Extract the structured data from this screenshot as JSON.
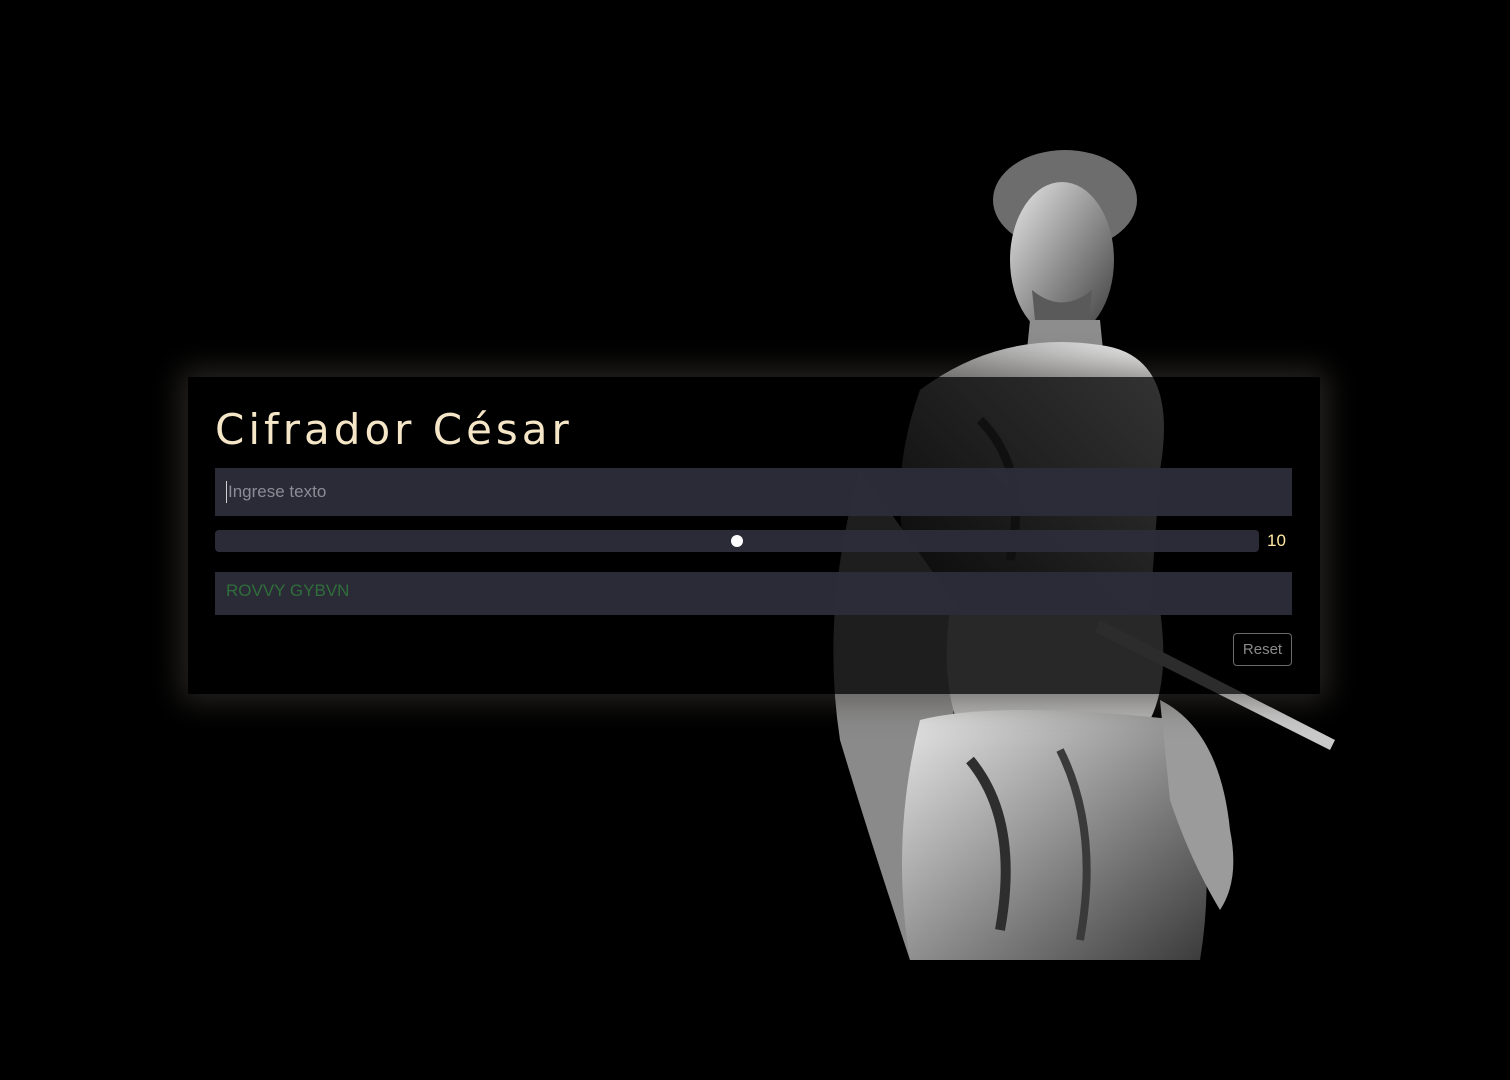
{
  "app": {
    "title": "Cifrador César"
  },
  "input": {
    "placeholder": "Ingrese texto",
    "value": ""
  },
  "shift_slider": {
    "value": 10,
    "min": 0,
    "max": 20,
    "value_label": "10"
  },
  "output": {
    "text": "ROVVY GYBVN"
  },
  "reset_button": {
    "label": "Reset"
  },
  "colors": {
    "background": "#000000",
    "title": "#f6e6c8",
    "field_bg": "#2c2c3a",
    "output_text": "#2f6e3a",
    "slider_value": "#ffe9a6"
  },
  "background_image": {
    "icon": "caesar-statue-image"
  }
}
